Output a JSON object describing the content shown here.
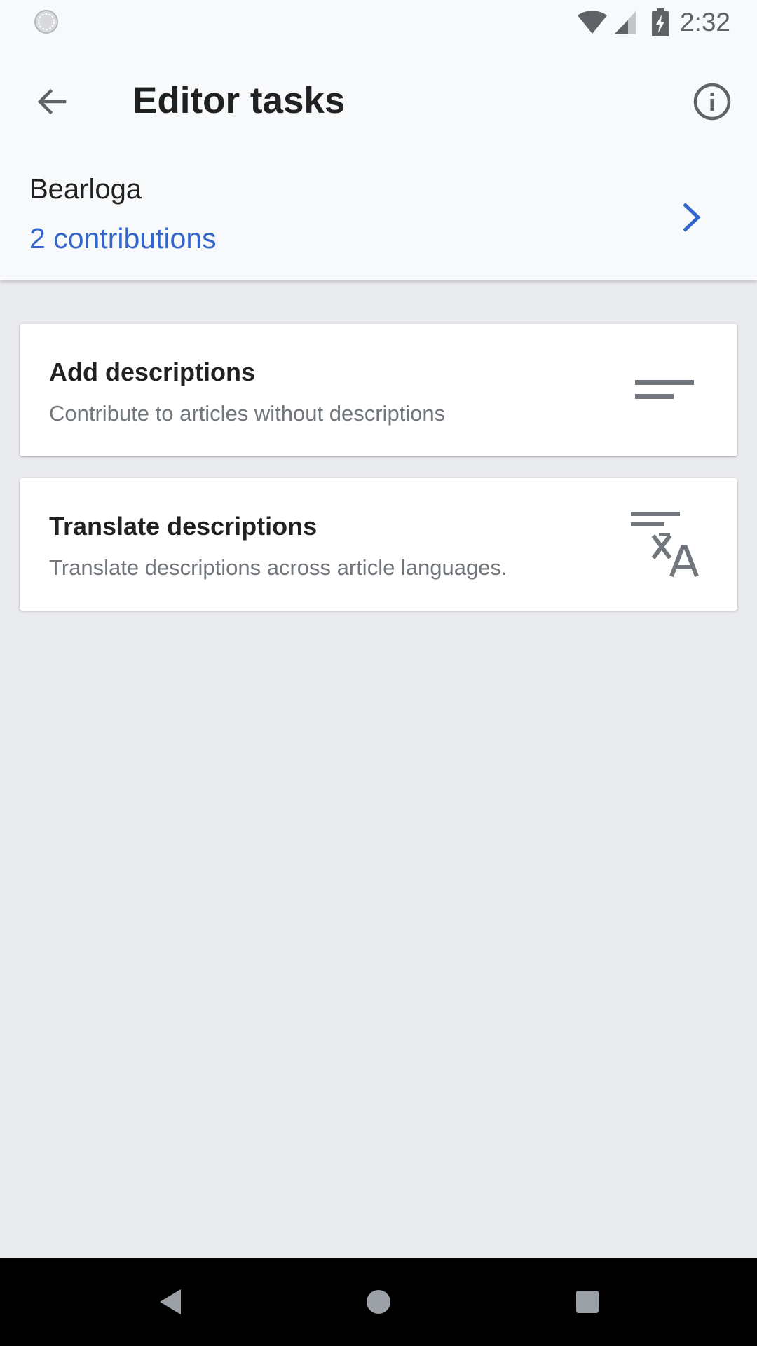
{
  "status_bar": {
    "time": "2:32",
    "icons": [
      "sync-icon",
      "wifi-icon",
      "cell-signal-icon",
      "battery-charging-icon"
    ]
  },
  "toolbar": {
    "title": "Editor tasks",
    "back_icon": "arrow-back-icon",
    "info_icon": "info-icon"
  },
  "user": {
    "name": "Bearloga",
    "contributions": "2 contributions",
    "chevron_icon": "chevron-right-icon"
  },
  "tasks": [
    {
      "title": "Add descriptions",
      "subtitle": "Contribute to articles without descriptions",
      "icon": "short-text-icon"
    },
    {
      "title": "Translate descriptions",
      "subtitle": "Translate descriptions across article languages.",
      "icon": "translate-icon"
    }
  ],
  "nav": {
    "icons": [
      "nav-back-icon",
      "nav-home-icon",
      "nav-recents-icon"
    ]
  },
  "colors": {
    "accent": "#3366cc",
    "header_bg": "#f8f9fa",
    "page_bg": "#eaebef",
    "icon_gray": "#72777d"
  }
}
